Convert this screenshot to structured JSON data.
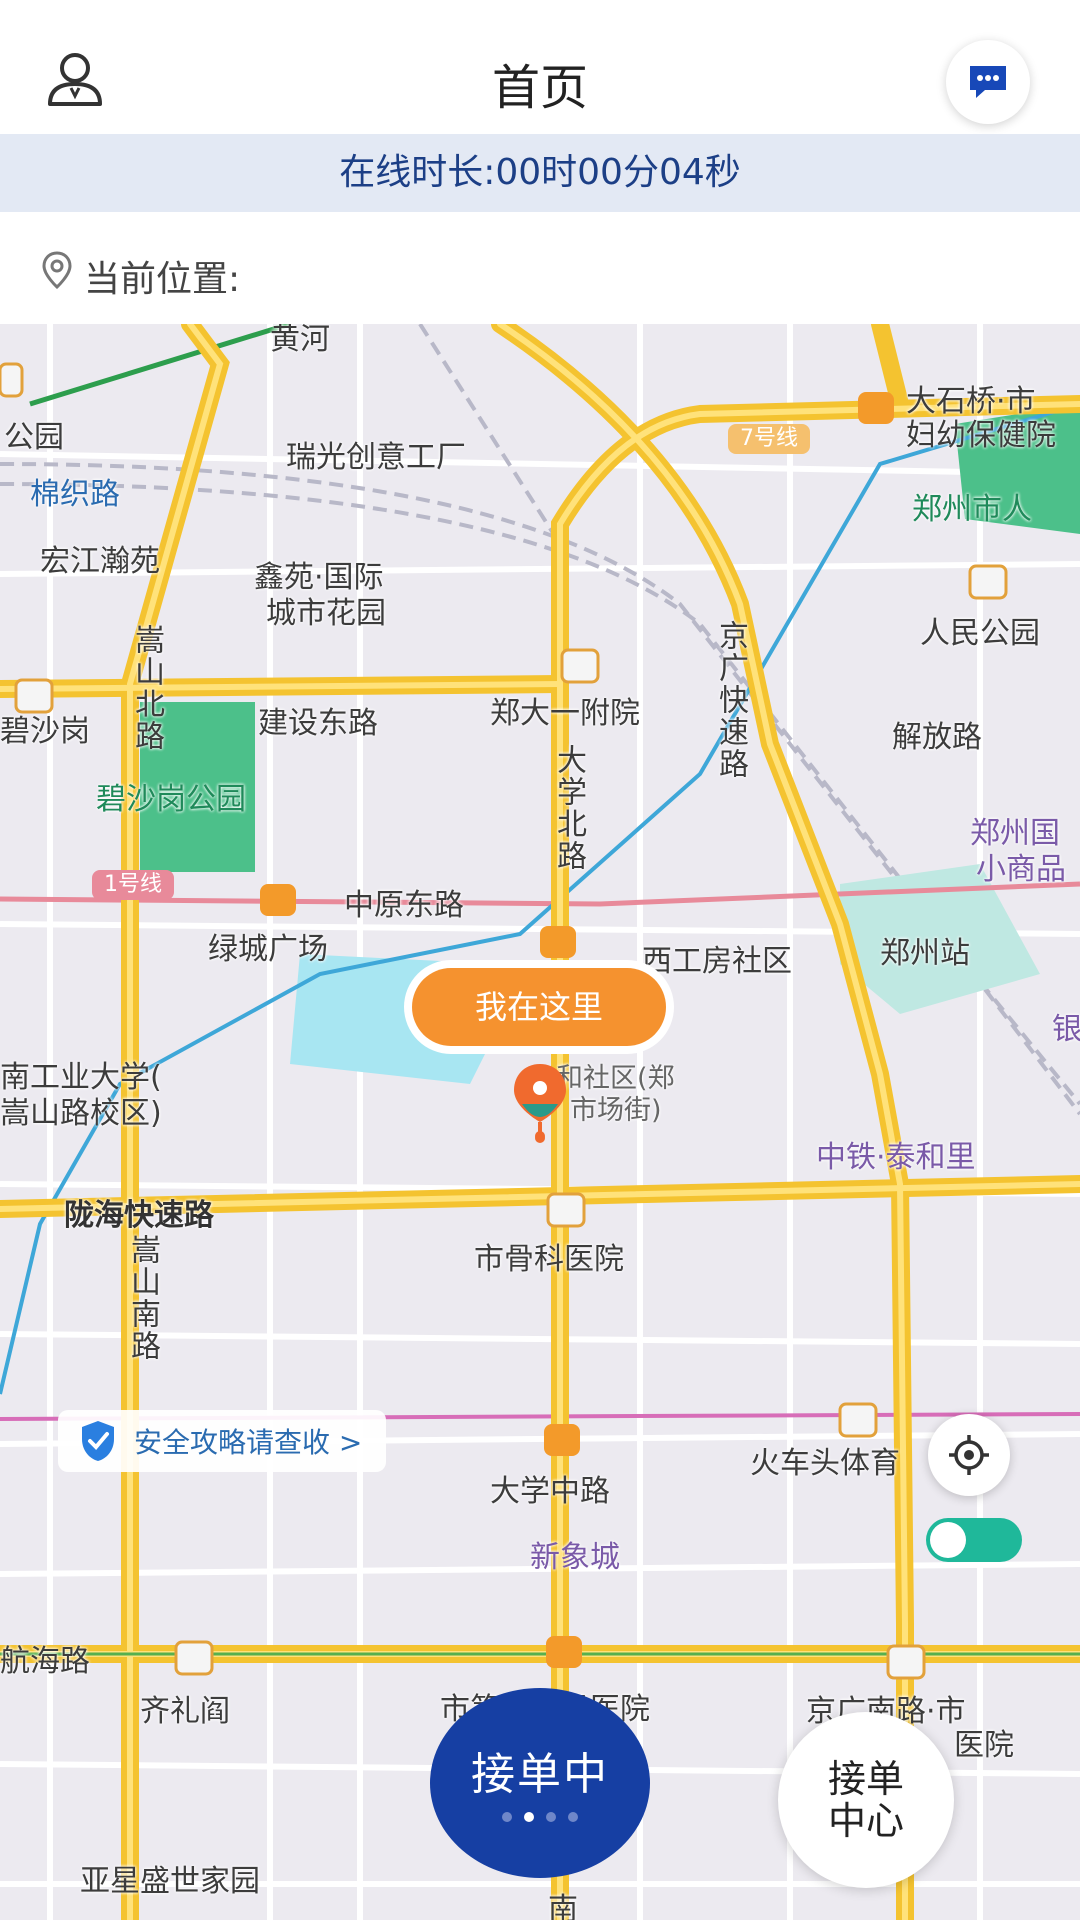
{
  "header": {
    "title": "首页",
    "profile_icon": "user-icon",
    "message_icon": "chat-bubble-icon"
  },
  "online": {
    "text": "在线时长:00时00分04秒"
  },
  "location": {
    "label": "当前位置:",
    "value": "",
    "icon": "location-pin-icon"
  },
  "map": {
    "labels": [
      {
        "text": "黄河",
        "kind": "road"
      },
      {
        "text": "公园",
        "kind": "plain"
      },
      {
        "text": "棉织路",
        "kind": "road"
      },
      {
        "text": "瑞光创意工厂",
        "kind": "plain"
      },
      {
        "text": "大石桥·市",
        "kind": "plain"
      },
      {
        "text": "妇幼保健院",
        "kind": "plain"
      },
      {
        "text": "7号线",
        "kind": "metro"
      },
      {
        "text": "郑州市人",
        "kind": "green"
      },
      {
        "text": "宏江瀚苑",
        "kind": "plain"
      },
      {
        "text": "鑫苑·国际",
        "kind": "plain"
      },
      {
        "text": "城市花园",
        "kind": "plain"
      },
      {
        "text": "人民公园",
        "kind": "plain"
      },
      {
        "text": "京广快速路",
        "kind": "road"
      },
      {
        "text": "嵩山北路",
        "kind": "road"
      },
      {
        "text": "碧沙岗",
        "kind": "plain"
      },
      {
        "text": "建设东路",
        "kind": "road"
      },
      {
        "text": "郑大一附院",
        "kind": "plain"
      },
      {
        "text": "解放路",
        "kind": "road"
      },
      {
        "text": "碧沙岗公园",
        "kind": "green"
      },
      {
        "text": "大学北路",
        "kind": "road"
      },
      {
        "text": "郑州国",
        "kind": "purple"
      },
      {
        "text": "小商品",
        "kind": "purple"
      },
      {
        "text": "1号线",
        "kind": "metro"
      },
      {
        "text": "中原东路",
        "kind": "road"
      },
      {
        "text": "绿城广场",
        "kind": "plain"
      },
      {
        "text": "西工房社区",
        "kind": "plain"
      },
      {
        "text": "郑州站",
        "kind": "plain"
      },
      {
        "text": "南工业大学(",
        "kind": "plain"
      },
      {
        "text": "嵩山路校区)",
        "kind": "plain"
      },
      {
        "text": "和社区(郑",
        "kind": "plain"
      },
      {
        "text": "市场街)",
        "kind": "plain"
      },
      {
        "text": "中铁·泰和里",
        "kind": "purple"
      },
      {
        "text": "陇海快速路",
        "kind": "road"
      },
      {
        "text": "市骨科医院",
        "kind": "plain"
      },
      {
        "text": "嵩山南路",
        "kind": "road"
      },
      {
        "text": "火车头体育",
        "kind": "plain"
      },
      {
        "text": "大学中路",
        "kind": "road"
      },
      {
        "text": "新象城",
        "kind": "purple"
      },
      {
        "text": "航海路",
        "kind": "road"
      },
      {
        "text": "齐礼阎",
        "kind": "plain"
      },
      {
        "text": "市第一人民医院",
        "kind": "plain"
      },
      {
        "text": "京广南路·市",
        "kind": "plain"
      },
      {
        "text": "医院",
        "kind": "plain"
      },
      {
        "text": "亚星盛世家园",
        "kind": "plain"
      },
      {
        "text": "银",
        "kind": "purple"
      },
      {
        "text": "南",
        "kind": "road"
      }
    ],
    "here_label": "我在这里",
    "safety_text": "安全攻略请查收 >",
    "locate_icon": "locate-crosshair-icon",
    "toggle_on": true
  },
  "bottom": {
    "order_status": "接单中",
    "order_center": "接单中心",
    "pager_active": 1
  },
  "colors": {
    "accent": "#163fa3",
    "orange": "#f5922f",
    "green_toggle": "#1fb89a",
    "banner": "#e3e9f4"
  }
}
